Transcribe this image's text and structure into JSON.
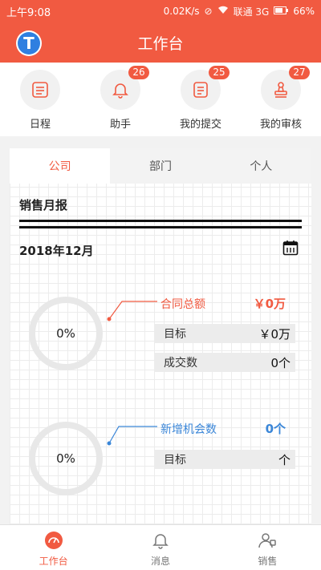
{
  "status": {
    "time": "上午9:08",
    "speed": "0.02K/s",
    "carrier": "联通 3G",
    "battery": "66%"
  },
  "header": {
    "title": "工作台",
    "logo_letter": "T"
  },
  "quick": [
    {
      "label": "日程",
      "badge": ""
    },
    {
      "label": "助手",
      "badge": "26"
    },
    {
      "label": "我的提交",
      "badge": "25"
    },
    {
      "label": "我的审核",
      "badge": "27"
    }
  ],
  "tabs": [
    "公司",
    "部门",
    "个人"
  ],
  "report": {
    "title": "销售月报",
    "month": "2018年12月"
  },
  "contract": {
    "percent": "0%",
    "label": "合同总额",
    "value": "￥0万",
    "target_label": "目标",
    "target_value": "￥0万",
    "deals_label": "成交数",
    "deals_value": "0个"
  },
  "opportunity": {
    "percent": "0%",
    "label": "新增机会数",
    "value": "0个",
    "target_label": "目标",
    "target_value": "个"
  },
  "nav": [
    {
      "label": "工作台"
    },
    {
      "label": "消息"
    },
    {
      "label": "销售"
    }
  ],
  "colors": {
    "accent": "#f15a41",
    "blue": "#3a86d8"
  }
}
